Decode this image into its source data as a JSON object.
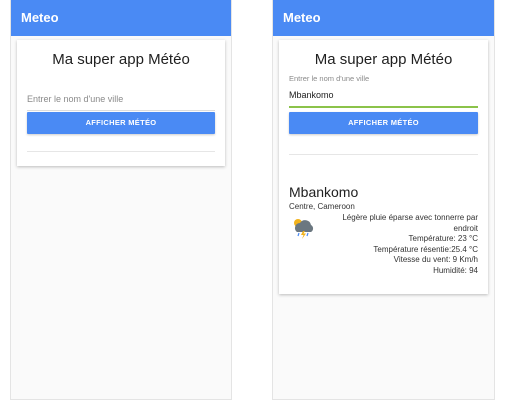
{
  "app": {
    "title": "Meteo"
  },
  "card": {
    "title": "Ma super app Météo"
  },
  "left_screen": {
    "input": {
      "placeholder": "Entrer le nom d'une ville",
      "value": ""
    },
    "button_label": "AFFICHER MÉTÉO"
  },
  "right_screen": {
    "input": {
      "label": "Entrer le nom d'une ville",
      "value": "Mbankomo"
    },
    "button_label": "AFFICHER MÉTÉO",
    "weather": {
      "city": "Mbankomo",
      "region": "Centre, Cameroon",
      "condition": "Légère pluie éparse avec tonnerre par endroit",
      "icon": "thunderstorm-icon",
      "temperature": "Température: 23 °C",
      "feels_like": "Température résentie:25.4 °C",
      "wind": "Vitesse du vent: 9 Km/h",
      "humidity": "Humidité: 94"
    }
  },
  "colors": {
    "primary": "#4a8af4",
    "input_focus": "#8bc34a"
  }
}
